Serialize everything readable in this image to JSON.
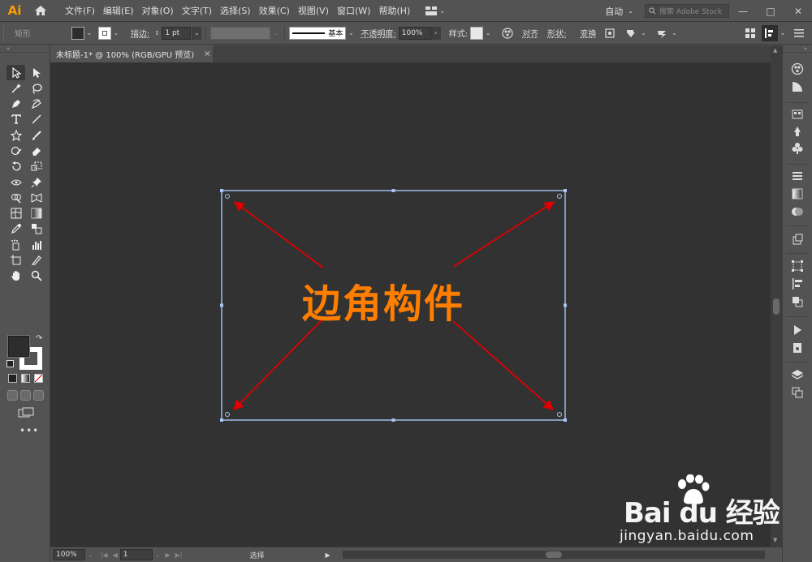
{
  "app": {
    "logo": "Ai",
    "menu": [
      "文件(F)",
      "编辑(E)",
      "对象(O)",
      "文字(T)",
      "选择(S)",
      "效果(C)",
      "视图(V)",
      "窗口(W)",
      "帮助(H)"
    ],
    "workspace": "自动",
    "stock_search_placeholder": "搜索 Adobe Stock"
  },
  "controlbar": {
    "object_type": "矩形",
    "stroke_label": "描边:",
    "stroke_weight": "1 pt",
    "brush_label": "基本",
    "opacity_label": "不透明度:",
    "opacity_value": "100%",
    "style_label": "样式:",
    "align_label": "对齐",
    "shape_label": "形状:",
    "transform_label": "变换"
  },
  "document": {
    "tab_title": "未标题-1* @ 100% (RGB/GPU 预览)",
    "close_glyph": "×"
  },
  "canvas": {
    "label": "边角构件",
    "label_color": "#ff7e00",
    "arrow_color": "#e00000",
    "selection_color": "#a9c5f5"
  },
  "statusbar": {
    "zoom": "100%",
    "artboard": "1",
    "status": "选择"
  },
  "watermark": {
    "brand": "Bai du 经验",
    "url": "jingyan.baidu.com"
  },
  "icons": {
    "home": "home-icon",
    "search": "search-icon",
    "minimize": "minimize-icon",
    "maximize": "maximize-icon",
    "close": "close-icon"
  }
}
